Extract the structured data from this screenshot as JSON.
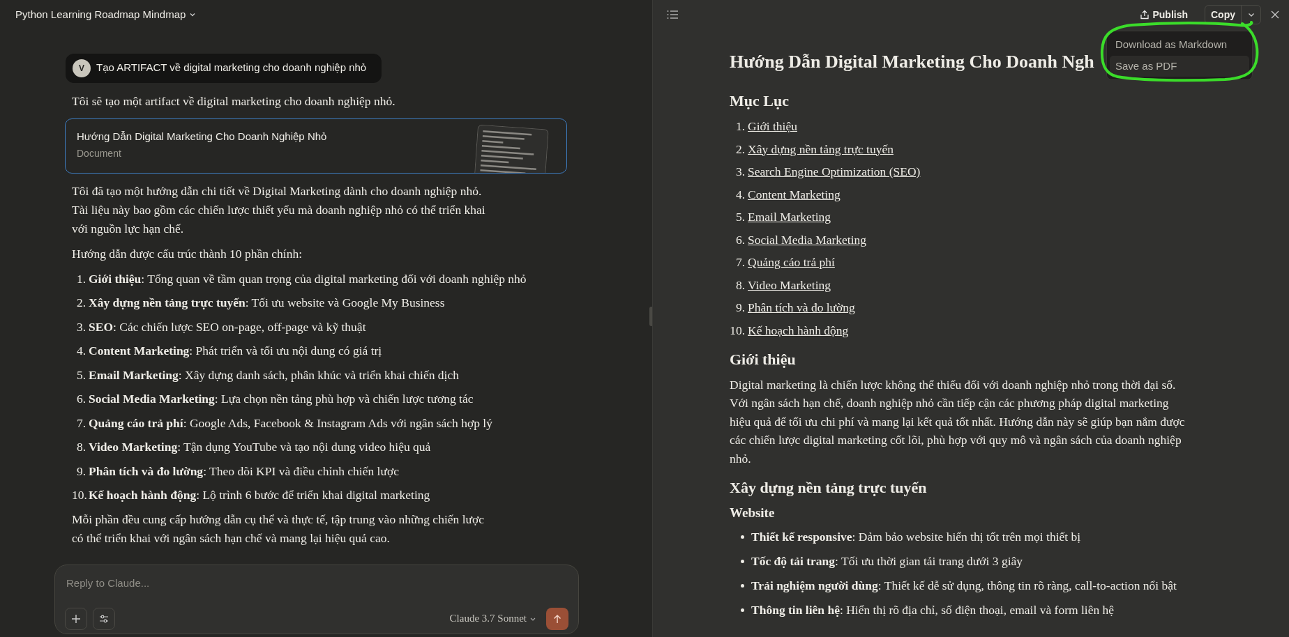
{
  "chat": {
    "title": "Python Learning Roadmap Mindmap",
    "user_message": {
      "avatar": "V",
      "text": "Tạo ARTIFACT về digital marketing cho doanh nghiệp nhỏ"
    },
    "intro": "Tôi sẽ tạo một artifact về digital marketing cho doanh nghiệp nhỏ.",
    "artifact": {
      "title": "Hướng Dẫn Digital Marketing Cho Doanh Nghiệp Nhỏ",
      "type": "Document"
    },
    "blocks": [
      {
        "kind": "paragraph",
        "text": "Tôi đã tạo một hướng dẫn chi tiết về Digital Marketing dành cho doanh nghiệp nhỏ. Tài liệu này bao gồm các chiến lược thiết yếu mà doanh nghiệp nhỏ có thể triển khai với nguồn lực hạn chế."
      },
      {
        "kind": "paragraph",
        "text": "Hướng dẫn được cấu trúc thành 10 phần chính:"
      },
      {
        "kind": "ordered",
        "items": [
          {
            "number": "1.",
            "text": "**Giới thiệu**: Tổng quan về tầm quan trọng của digital marketing đối với doanh nghiệp nhỏ"
          },
          {
            "number": "2.",
            "text": "**Xây dựng nền tảng trực tuyến**: Tối ưu website và Google My Business"
          },
          {
            "number": "3.",
            "text": "**SEO**: Các chiến lược SEO on-page, off-page và kỹ thuật"
          },
          {
            "number": "4.",
            "text": "**Content Marketing**: Phát triển và tối ưu nội dung có giá trị"
          },
          {
            "number": "5.",
            "text": "**Email Marketing**: Xây dựng danh sách, phân khúc và triển khai chiến dịch"
          },
          {
            "number": "6.",
            "text": "**Social Media Marketing**: Lựa chọn nền tảng phù hợp và chiến lược tương tác"
          },
          {
            "number": "7.",
            "text": "**Quảng cáo trả phí**: Google Ads, Facebook & Instagram Ads với ngân sách hợp lý"
          },
          {
            "number": "8.",
            "text": "**Video Marketing**: Tận dụng YouTube và tạo nội dung video hiệu quả"
          },
          {
            "number": "9.",
            "text": "**Phân tích và đo lường**: Theo dõi KPI và điều chỉnh chiến lược"
          },
          {
            "number": "10.",
            "text": "**Kế hoạch hành động**: Lộ trình 6 bước để triển khai digital marketing"
          }
        ]
      },
      {
        "kind": "paragraph",
        "text": "Mỗi phần đều cung cấp hướng dẫn cụ thể và thực tế, tập trung vào những chiến lược có thể triển khai với ngân sách hạn chế và mang lại hiệu quả cao."
      }
    ],
    "composer": {
      "placeholder": "Reply to Claude...",
      "model": "Claude 3.7 Sonnet"
    }
  },
  "artifact_panel": {
    "publish": "Publish",
    "copy": "Copy",
    "menu": [
      {
        "label": "Download as Markdown",
        "selected": false
      },
      {
        "label": "Save as PDF",
        "selected": true
      }
    ],
    "document": {
      "title": "Hướng Dẫn Digital Marketing Cho Doanh Ngh",
      "blocks": [
        {
          "kind": "h2",
          "text": "Mục Lục"
        },
        {
          "kind": "toc",
          "items": [
            {
              "number": "1.",
              "text": "Giới thiệu"
            },
            {
              "number": "2.",
              "text": "Xây dựng nền tảng trực tuyến"
            },
            {
              "number": "3.",
              "text": "Search Engine Optimization (SEO)"
            },
            {
              "number": "4.",
              "text": "Content Marketing"
            },
            {
              "number": "5.",
              "text": "Email Marketing"
            },
            {
              "number": "6.",
              "text": "Social Media Marketing"
            },
            {
              "number": "7.",
              "text": "Quảng cáo trả phí"
            },
            {
              "number": "8.",
              "text": "Video Marketing"
            },
            {
              "number": "9.",
              "text": "Phân tích và đo lường"
            },
            {
              "number": "10.",
              "text": "Kế hoạch hành động"
            }
          ]
        },
        {
          "kind": "h2",
          "text": "Giới thiệu"
        },
        {
          "kind": "paragraph",
          "text": "Digital marketing là chiến lược không thể thiếu đối với doanh nghiệp nhỏ trong thời đại số. Với ngân sách hạn chế, doanh nghiệp nhỏ cần tiếp cận các phương pháp digital marketing hiệu quả để tối ưu chi phí và mang lại kết quả tốt nhất. Hướng dẫn này sẽ giúp bạn nắm được các chiến lược digital marketing cốt lõi, phù hợp với quy mô và ngân sách của doanh nghiệp nhỏ."
        },
        {
          "kind": "h2",
          "text": "Xây dựng nền tảng trực tuyến"
        },
        {
          "kind": "h3",
          "text": "Website"
        },
        {
          "kind": "bullets",
          "items": [
            "**Thiết kế responsive**: Đảm bảo website hiển thị tốt trên mọi thiết bị",
            "**Tốc độ tải trang**: Tối ưu thời gian tải trang dưới 3 giây",
            "**Trải nghiệm người dùng**: Thiết kế dễ sử dụng, thông tin rõ ràng, call-to-action nổi bật",
            "**Thông tin liên hệ**: Hiển thị rõ địa chỉ, số điện thoại, email và form liên hệ"
          ]
        }
      ]
    }
  }
}
